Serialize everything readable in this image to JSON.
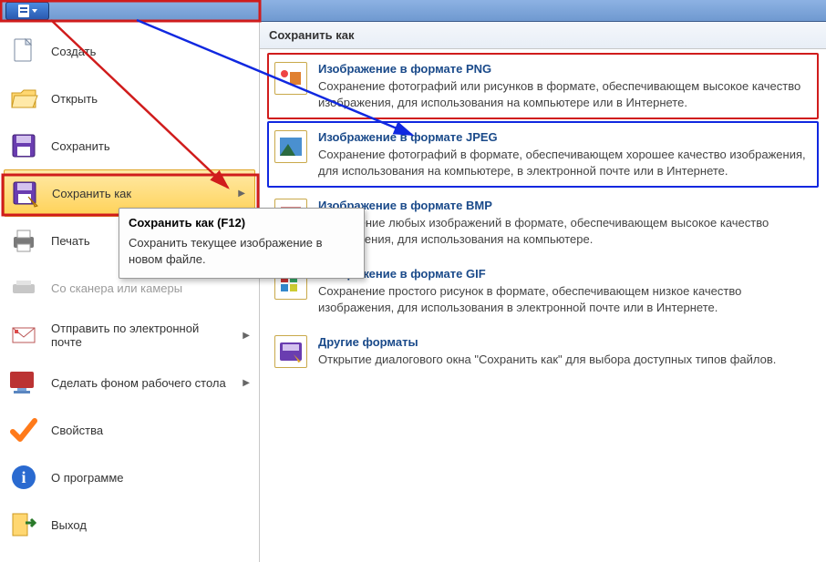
{
  "titlebar": {
    "file_button": "file-menu"
  },
  "left_menu": {
    "items": [
      {
        "label": "Создать",
        "icon": "new-doc-icon"
      },
      {
        "label": "Открыть",
        "icon": "open-folder-icon"
      },
      {
        "label": "Сохранить",
        "icon": "save-floppy-icon"
      },
      {
        "label": "Сохранить как",
        "icon": "save-as-floppy-icon",
        "selected": true,
        "has_submenu": true
      },
      {
        "label": "Печать",
        "icon": "printer-icon",
        "has_submenu": true
      },
      {
        "label": "Со сканера или камеры",
        "icon": "scanner-icon",
        "disabled": true
      },
      {
        "label": "Отправить по электронной почте",
        "icon": "envelope-icon",
        "has_submenu": true
      },
      {
        "label": "Сделать фоном рабочего стола",
        "icon": "desktop-bg-icon",
        "has_submenu": true
      },
      {
        "label": "Свойства",
        "icon": "properties-check-icon"
      },
      {
        "label": "О программе",
        "icon": "info-icon"
      },
      {
        "label": "Выход",
        "icon": "exit-door-icon"
      }
    ]
  },
  "tooltip": {
    "title": "Сохранить как (F12)",
    "body": "Сохранить текущее изображение в новом файле."
  },
  "right_pane": {
    "header": "Сохранить как",
    "formats": [
      {
        "title": "Изображение в формате PNG",
        "desc": "Сохранение фотографий или рисунков в формате, обеспечивающем высокое качество изображения, для использования на компьютере или в Интернете.",
        "icon": "png-icon",
        "highlight": "red"
      },
      {
        "title": "Изображение в формате JPEG",
        "desc": "Сохранение фотографий в формате, обеспечивающем хорошее качество изображения, для использования на компьютере, в электронной почте или в Интернете.",
        "icon": "jpeg-icon",
        "highlight": "blue"
      },
      {
        "title": "Изображение в формате BMP",
        "desc": "Сохранение любых изображений в формате, обеспечивающем высокое качество изображения, для использования на компьютере.",
        "icon": "bmp-icon"
      },
      {
        "title": "Изображение в формате GIF",
        "desc": "Сохранение простого рисунок в формате, обеспечивающем низкое качество изображения, для использования в электронной почте или в Интернете.",
        "icon": "gif-icon"
      },
      {
        "title": "Другие форматы",
        "desc": "Открытие диалогового окна \"Сохранить как\" для выбора доступных типов файлов.",
        "icon": "other-formats-icon"
      }
    ]
  },
  "annotations": {
    "top_box": "titlebar-highlight",
    "saveas_box": "saveas-highlight",
    "arrow_red": "red-arrow",
    "arrow_blue": "blue-arrow"
  }
}
